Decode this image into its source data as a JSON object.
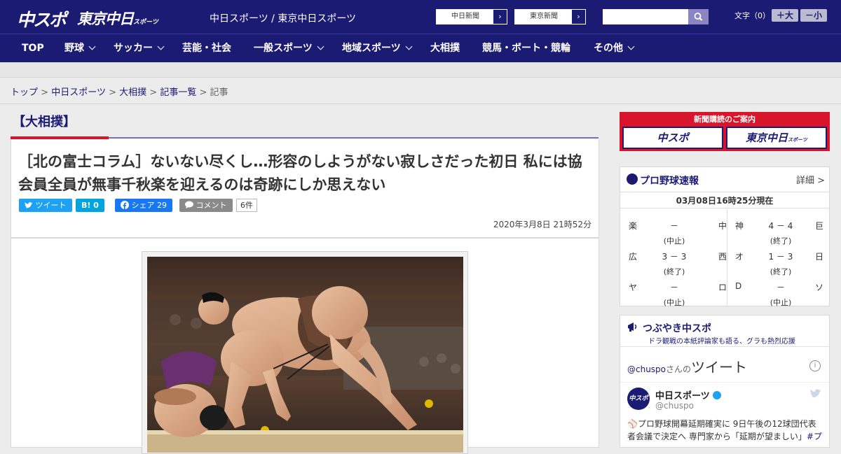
{
  "header": {
    "logo_main": "中スポ",
    "logo_tokyo": "東京中日",
    "logo_tokyo_small": "スポーツ",
    "site_title": "中日スポーツ / 東京中日スポーツ",
    "paper_links": [
      "中日新聞",
      "東京新聞"
    ],
    "search_placeholder": "",
    "font_size_label": "文字（0）",
    "font_bigger": "＋大",
    "font_smaller": "－小"
  },
  "nav": {
    "items": [
      {
        "label": "TOP"
      },
      {
        "label": "野球"
      },
      {
        "label": "サッカー"
      },
      {
        "label": "芸能・社会"
      },
      {
        "label": "一般スポーツ"
      },
      {
        "label": "地域スポーツ"
      },
      {
        "label": "大相撲"
      },
      {
        "label": "競馬・ボート・競輪"
      },
      {
        "label": "その他"
      }
    ]
  },
  "breadcrumb": {
    "items": [
      "トップ",
      "中日スポーツ",
      "大相撲",
      "記事一覧"
    ],
    "current": "記事",
    "separator": ">"
  },
  "article": {
    "category": "【大相撲】",
    "headline": "［北の富士コラム］ないない尽くし…形容のしようがない寂しさだった初日 私には協会員全員が無事千秋楽を迎えるのは奇跡にしか思えない",
    "share": {
      "tweet": "ツイート",
      "hatena": "B! 0",
      "facebook": "シェア 29",
      "comment": "コメント",
      "comment_count": "6件"
    },
    "date": "2020年3月8日 21時52分"
  },
  "sidebar": {
    "ad": {
      "title": "新聞購読のご案内",
      "buttons": [
        "中スポ",
        "東京中日"
      ],
      "button_small": "スポーツ"
    },
    "baseball": {
      "title": "プロ野球速報",
      "detail": "詳細 >",
      "updated": "03月08日16時25分現在",
      "games": [
        {
          "home": "楽",
          "score": "－",
          "away": "中",
          "status": "(中止)"
        },
        {
          "home": "神",
          "score": "4 － 4",
          "away": "巨",
          "status": "(終了)"
        },
        {
          "home": "広",
          "score": "3 － 3",
          "away": "西",
          "status": "(終了)"
        },
        {
          "home": "オ",
          "score": "1 － 3",
          "away": "日",
          "status": "(終了)"
        },
        {
          "home": "ヤ",
          "score": "－",
          "away": "ロ",
          "status": "(中止)"
        },
        {
          "home": "D",
          "score": "－",
          "away": "ソ",
          "status": "(中止)"
        }
      ]
    },
    "tweets": {
      "title": "つぶやき中スポ",
      "subtitle": "ドラ観戦の本紙評論家も語る、グラも熱烈応援",
      "handle": "@chuspo",
      "handle_suffix": "さんの",
      "label": "ツイート",
      "tweet_name": "中日スポーツ",
      "tweet_screen": "@chuspo",
      "avatar_text": "中スポ",
      "tweet_text": "プロ野球開幕延期確実に 9日午後の12球団代表者会議で決定へ 専門家から「延期が望ましい」",
      "tweet_tag": "#プ"
    }
  },
  "colors": {
    "brand_navy": "#1c1b74",
    "accent_red": "#d8152b",
    "accent_purple": "#7d71ac"
  }
}
